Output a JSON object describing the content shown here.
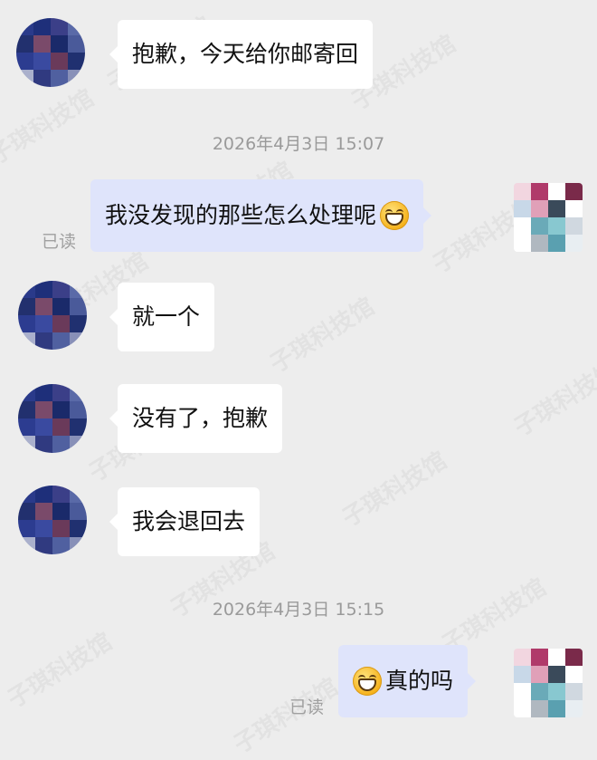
{
  "watermark_text": "子琪科技馆",
  "messages": {
    "m1": "抱歉，今天给你邮寄回",
    "ts1": "2026年4月3日 15:07",
    "m2": "我没发现的那些怎么处理呢",
    "m2_read": "已读",
    "m3": "就一个",
    "m4": "没有了，抱歉",
    "m5": "我会退回去",
    "ts2": "2026年4月3日 15:15",
    "m6": "真的吗",
    "m6_read": "已读"
  },
  "emoji": {
    "name": "grinning-face-icon"
  },
  "avatars": {
    "left_palette": [
      "#2a3a8a",
      "#1e2f7a",
      "#3b3f88",
      "#5a6aa8",
      "#22306e",
      "#7a4a6a",
      "#1a2a6a",
      "#4a5a9a",
      "#2c3c90",
      "#3a4aa0",
      "#6a3a5a",
      "#203070",
      "#aab0cc",
      "#303a80",
      "#5060a0",
      "#8890b8"
    ],
    "right_palette": [
      "#f2d6e0",
      "#b03a6a",
      "#ffffff",
      "#7a2a4a",
      "#c8d8e8",
      "#e0a0b8",
      "#3a4a5a",
      "#ffffff",
      "#ffffff",
      "#6aaab8",
      "#88c8d0",
      "#d0d8e0",
      "#ffffff",
      "#b0b8c0",
      "#5aa0b0",
      "#e8eef2"
    ]
  }
}
